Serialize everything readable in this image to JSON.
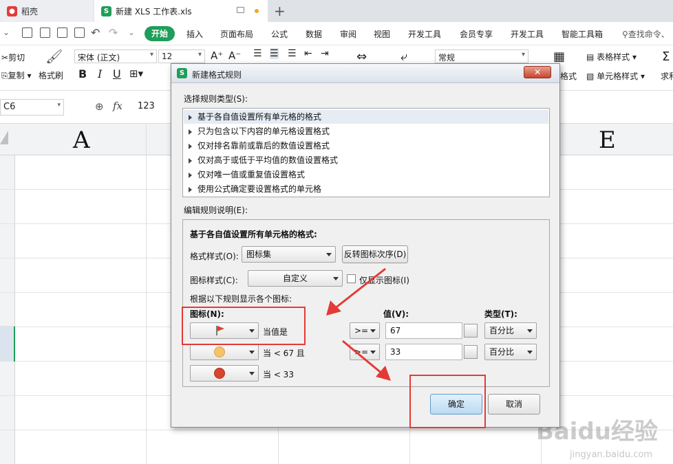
{
  "tabs": [
    {
      "label": "稻壳",
      "icon": "daoke-icon"
    },
    {
      "label": "新建 XLS 工作表.xls",
      "icon": "spreadsheet-icon"
    }
  ],
  "menu": {
    "start": "开始",
    "items": [
      "插入",
      "页面布局",
      "公式",
      "数据",
      "审阅",
      "视图",
      "开发工具",
      "会员专享",
      "开发工具",
      "智能工具箱"
    ],
    "search": "查找命令、"
  },
  "ribbon": {
    "cut": "剪切",
    "copy": "复制",
    "format_painter": "格式刷",
    "font": "宋体 (正文)",
    "size": "12",
    "number_format": "常规",
    "table_style": "表格样式",
    "cell_style": "单元格样式",
    "conditional": "格式",
    "sum": "求和",
    "bold": "B",
    "italic": "I",
    "underline": "U"
  },
  "formula_bar": {
    "cell": "C6",
    "value": "123",
    "fx": "fx"
  },
  "columns": {
    "a": "A",
    "e": "E"
  },
  "dialog": {
    "title": "新建格式规则",
    "select_type_label": "选择规则类型(S):",
    "rule_types": [
      "基于各自值设置所有单元格的格式",
      "只为包含以下内容的单元格设置格式",
      "仅对排名靠前或靠后的数值设置格式",
      "仅对高于或低于平均值的数值设置格式",
      "仅对唯一值或重复值设置格式",
      "使用公式确定要设置格式的单元格"
    ],
    "edit_label": "编辑规则说明(E):",
    "section_title": "基于各自值设置所有单元格的格式:",
    "format_style_label": "格式样式(O):",
    "format_style_value": "图标集",
    "reverse_button": "反转图标次序(D)",
    "icon_style_label": "图标样式(C):",
    "icon_style_value": "自定义",
    "show_icon_only": "仅显示图标(I)",
    "rules_label": "根据以下规则显示各个图标:",
    "col_icon": "图标(N):",
    "col_value": "值(V):",
    "col_type": "类型(T):",
    "rows": [
      {
        "icon": "red-flag-icon",
        "cond": "当值是",
        "op": ">=",
        "value": "67",
        "type": "百分比"
      },
      {
        "icon": "yellow-circle-icon",
        "cond": "当 < 67 且",
        "op": ">=",
        "value": "33",
        "type": "百分比"
      },
      {
        "icon": "red-circle-icon",
        "cond": "当 < 33"
      }
    ],
    "ok": "确定",
    "cancel": "取消"
  },
  "watermark": {
    "brand": "Baidu经验",
    "url": "jingyan.baidu.com"
  },
  "colors": {
    "accent": "#1e9e5a",
    "highlight": "#e53935",
    "ok_button": "#c9e3f6"
  }
}
